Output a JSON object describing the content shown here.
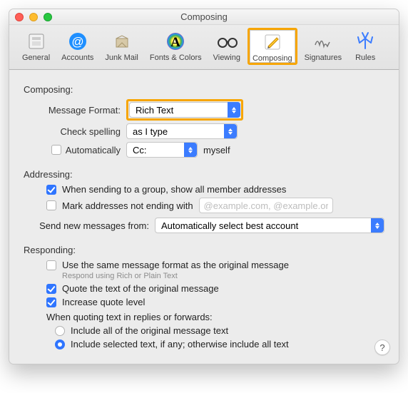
{
  "window": {
    "title": "Composing"
  },
  "toolbar": {
    "items": [
      {
        "label": "General"
      },
      {
        "label": "Accounts"
      },
      {
        "label": "Junk Mail"
      },
      {
        "label": "Fonts & Colors"
      },
      {
        "label": "Viewing"
      },
      {
        "label": "Composing"
      },
      {
        "label": "Signatures"
      },
      {
        "label": "Rules"
      }
    ]
  },
  "composing": {
    "section": "Composing:",
    "format_label": "Message Format:",
    "format_value": "Rich Text",
    "spell_label": "Check spelling",
    "spell_value": "as I type",
    "auto_label": "Automatically",
    "auto_field_value": "Cc:",
    "auto_suffix": "myself"
  },
  "addressing": {
    "section": "Addressing:",
    "group_label": "When sending to a group, show all member addresses",
    "mark_label": "Mark addresses not ending with",
    "mark_placeholder": "@example.com, @example.org",
    "send_from_label": "Send new messages from:",
    "send_from_value": "Automatically select best account"
  },
  "responding": {
    "section": "Responding:",
    "same_format_label": "Use the same message format as the original message",
    "same_format_hint": "Respond using Rich or Plain Text",
    "quote_label": "Quote the text of the original message",
    "increase_label": "Increase quote level",
    "quoting_header": "When quoting text in replies or forwards:",
    "include_all_label": "Include all of the original message text",
    "include_selected_label": "Include selected text, if any; otherwise include all text"
  },
  "help": "?"
}
